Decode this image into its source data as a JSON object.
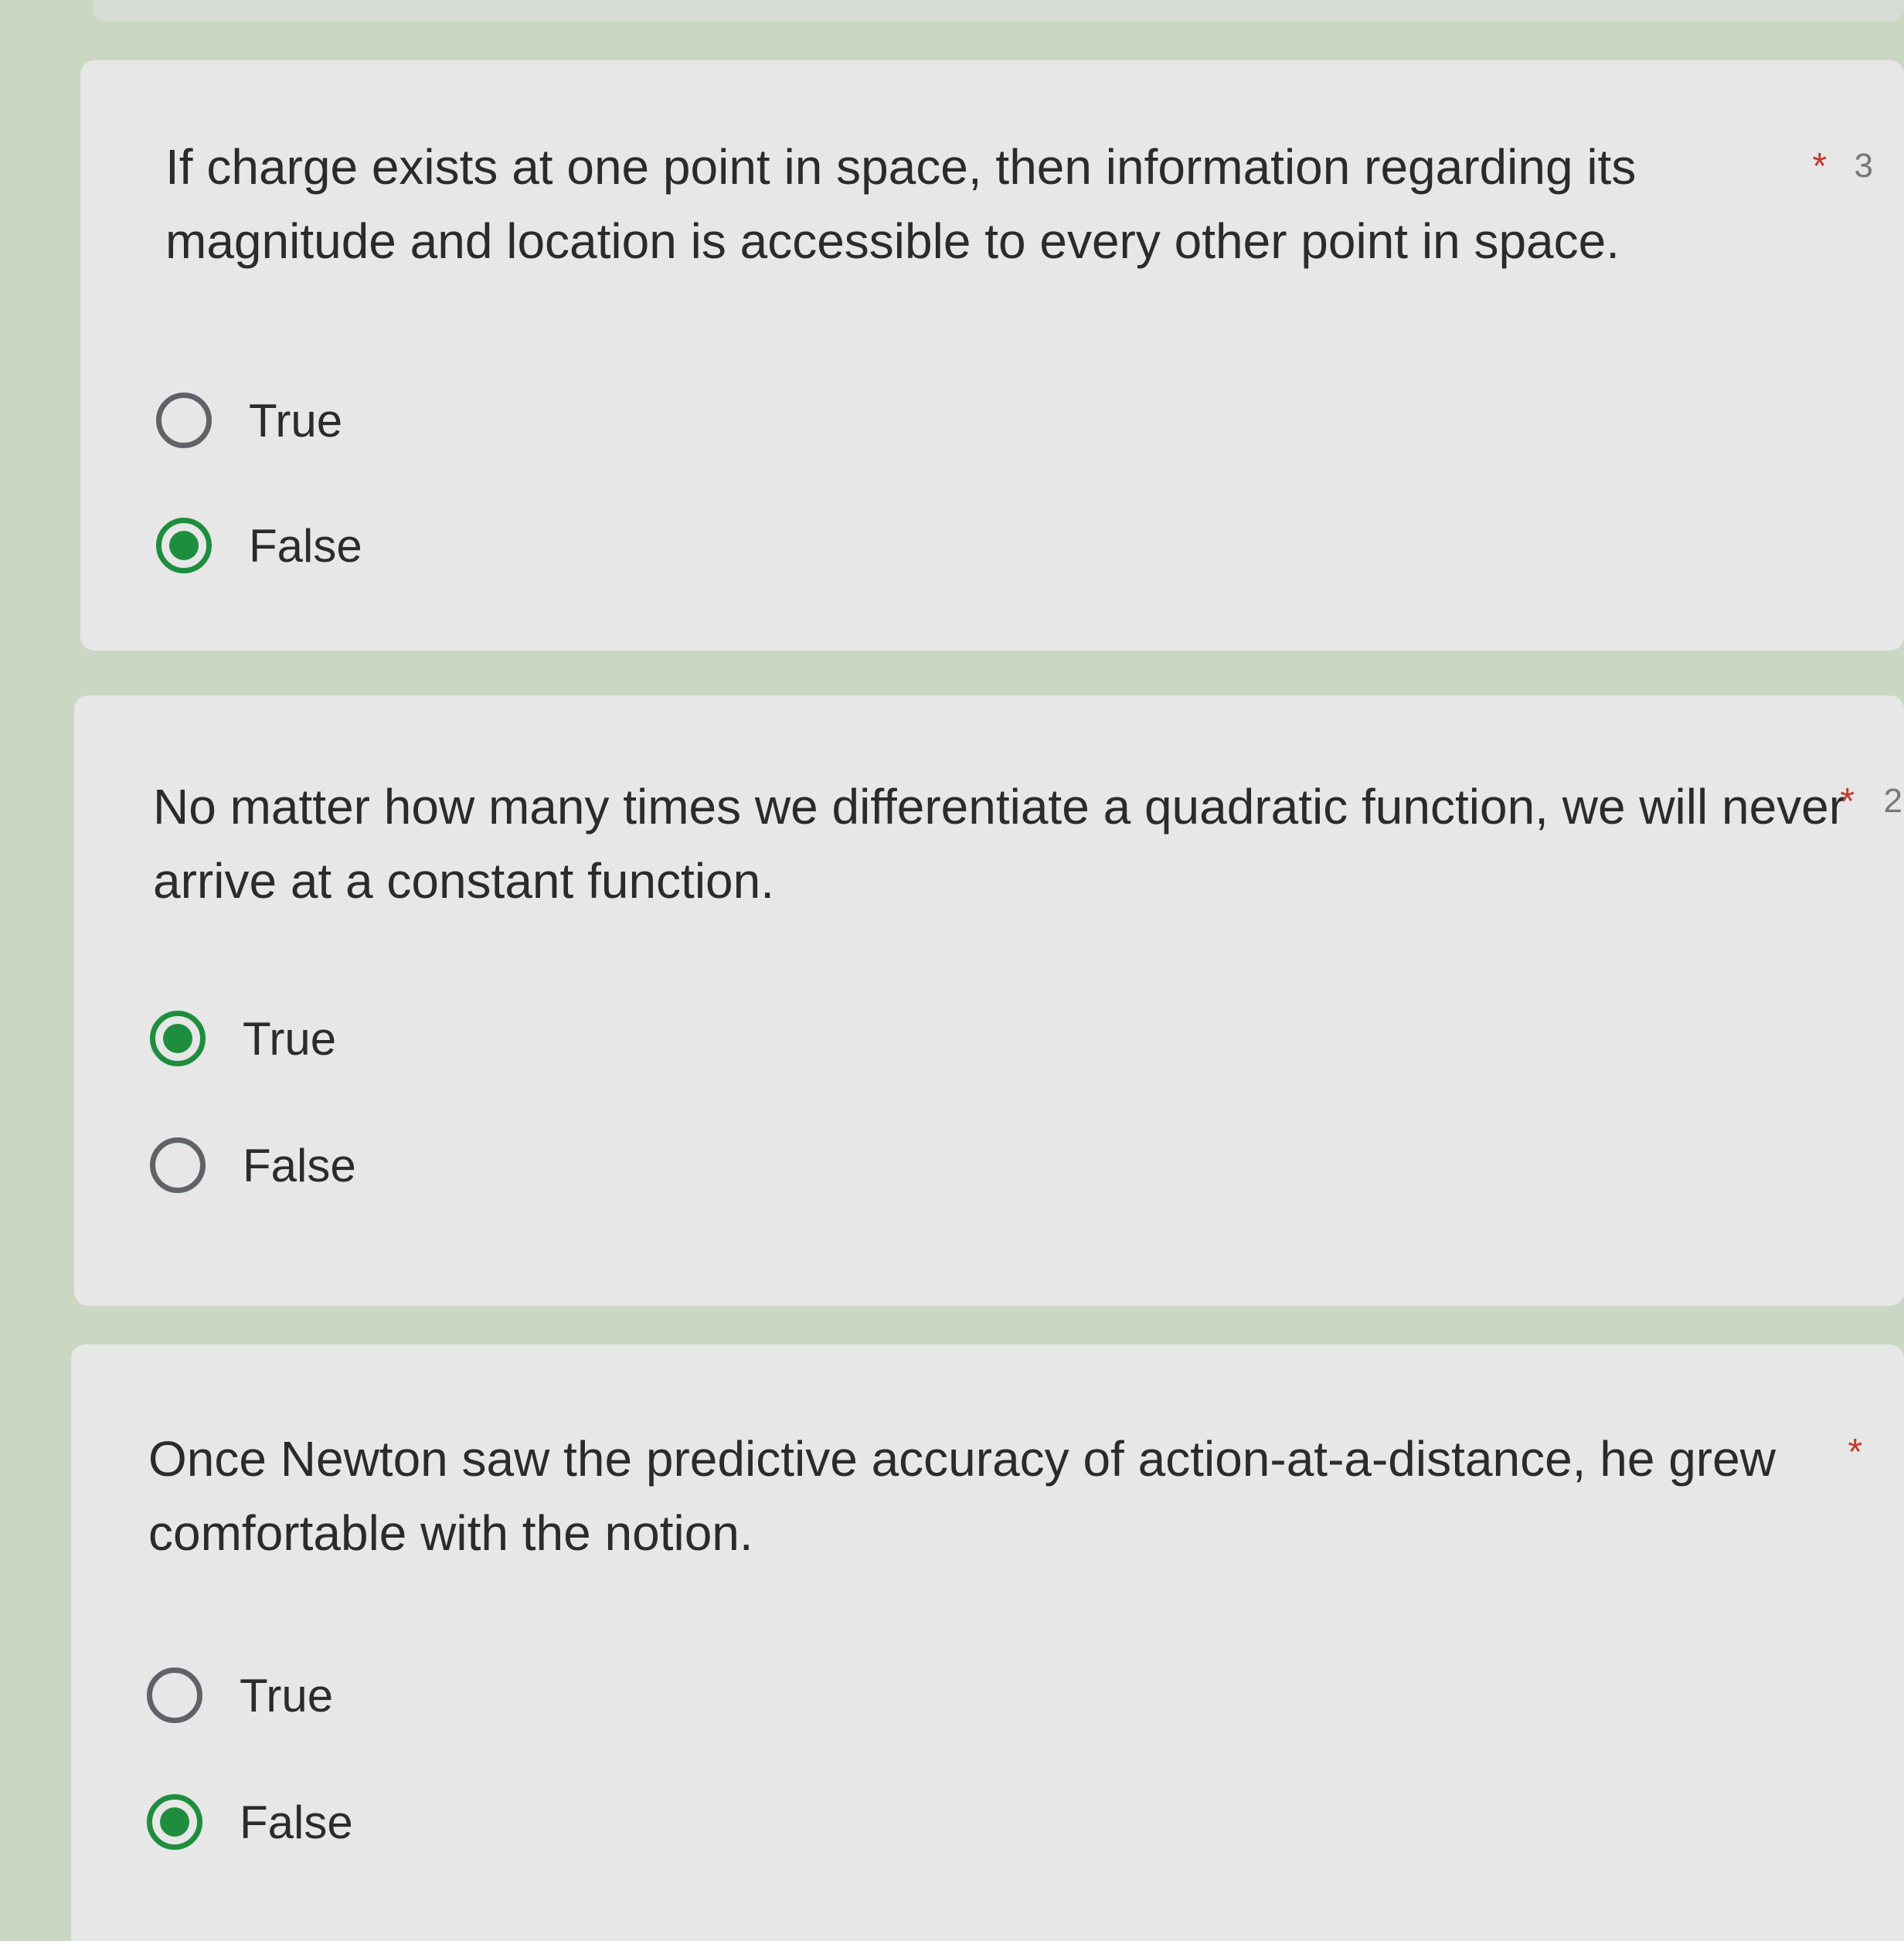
{
  "accent_color": "#1e8e3e",
  "questions": [
    {
      "text": "If charge exists at one point in space, then information regarding its magnitude and location is accessible to every other point in space.",
      "required_marker": "*",
      "points_partial": "3",
      "options": [
        {
          "label": "True",
          "selected": false
        },
        {
          "label": "False",
          "selected": true
        }
      ]
    },
    {
      "text": "No matter how many times we differentiate a quadratic function, we will never arrive at a constant function.",
      "required_marker": "*",
      "points_partial": "2",
      "options": [
        {
          "label": "True",
          "selected": true
        },
        {
          "label": "False",
          "selected": false
        }
      ]
    },
    {
      "text": "Once Newton saw the predictive accuracy of action-at-a-distance, he grew comfortable with the notion.",
      "required_marker": "*",
      "points_partial": "",
      "options": [
        {
          "label": "True",
          "selected": false
        },
        {
          "label": "False",
          "selected": true
        }
      ]
    }
  ]
}
